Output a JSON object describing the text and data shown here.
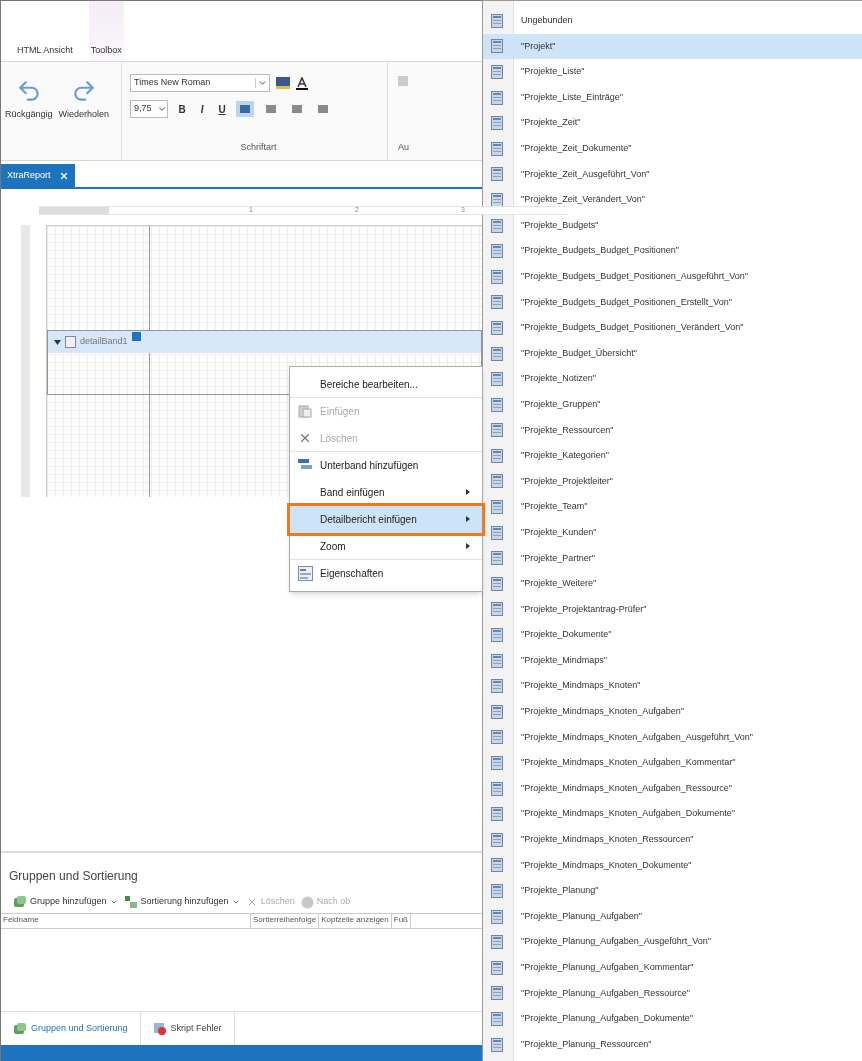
{
  "ribbon": {
    "tabs": [
      {
        "label": "HTML Ansicht",
        "contextual": false
      },
      {
        "label": "Toolbox",
        "contextual": true
      }
    ],
    "undo": "Rückgängig",
    "redo": "Wiederholen",
    "font": {
      "value": "Times New Roman"
    },
    "size": {
      "value": "9,75"
    },
    "format_buttons": [
      {
        "label": "B",
        "kind": "bold"
      },
      {
        "label": "I",
        "kind": "italic"
      },
      {
        "label": "U",
        "kind": "underline"
      }
    ],
    "align_buttons": [
      {
        "selected": true
      },
      {
        "selected": false
      },
      {
        "selected": false
      },
      {
        "selected": false
      }
    ],
    "group_label": "Schriftart",
    "next_group_label": "Au"
  },
  "document_tab": {
    "label": "XtraReport"
  },
  "ruler_labels": [
    "1",
    "2",
    "3"
  ],
  "band": {
    "label": "detailBand1",
    "expanded": true
  },
  "context_menu": [
    {
      "label": "Bereiche bearbeiten...",
      "kind": "none",
      "disabled": false,
      "submenu": false,
      "selected": false,
      "separator_after": true
    },
    {
      "label": "Einfügen",
      "kind": "paste",
      "disabled": true,
      "submenu": false,
      "selected": false,
      "separator_after": false
    },
    {
      "label": "Löschen",
      "kind": "delete",
      "disabled": true,
      "submenu": false,
      "selected": false,
      "separator_after": true
    },
    {
      "label": "Unterband hinzufügen",
      "kind": "subband",
      "disabled": false,
      "submenu": false,
      "selected": false,
      "separator_after": false
    },
    {
      "label": "Band einfügen",
      "kind": "none",
      "disabled": false,
      "submenu": true,
      "selected": false,
      "separator_after": false
    },
    {
      "label": "Detailbericht einfügen",
      "kind": "none",
      "disabled": false,
      "submenu": true,
      "selected": true,
      "separator_after": false
    },
    {
      "label": "Zoom",
      "kind": "none",
      "disabled": false,
      "submenu": true,
      "selected": false,
      "separator_after": true
    },
    {
      "label": "Eigenschaften",
      "kind": "properties",
      "disabled": false,
      "submenu": false,
      "selected": false,
      "separator_after": false
    }
  ],
  "bottom_panel": {
    "title": "Gruppen und Sortierung",
    "toolbar": [
      {
        "label": "Gruppe hinzufügen",
        "kind": "group",
        "dropdown": true,
        "disabled": false
      },
      {
        "label": "Sortierung hinzufügen",
        "kind": "sort",
        "dropdown": true,
        "disabled": false
      },
      {
        "label": "Löschen",
        "kind": "delete",
        "dropdown": false,
        "disabled": true
      },
      {
        "label": "Nach ob",
        "kind": "up",
        "dropdown": false,
        "disabled": true
      }
    ],
    "columns": [
      "Feldname",
      "Sortierreihenfolge",
      "Kopfzeile anzeigen",
      "Fuß"
    ],
    "tabs": [
      {
        "label": "Gruppen und Sortierung",
        "kind": "group",
        "selected": true
      },
      {
        "label": "Skript Fehler",
        "kind": "error",
        "selected": false
      }
    ]
  },
  "data_source_list": [
    {
      "label": "Ungebunden",
      "selected": false
    },
    {
      "label": "\"Projekt\"",
      "selected": true
    },
    {
      "label": "\"Projekte_Liste\"",
      "selected": false
    },
    {
      "label": "\"Projekte_Liste_Einträge\"",
      "selected": false
    },
    {
      "label": "\"Projekte_Zeit\"",
      "selected": false
    },
    {
      "label": "\"Projekte_Zeit_Dokumente\"",
      "selected": false
    },
    {
      "label": "\"Projekte_Zeit_Ausgeführt_Von\"",
      "selected": false
    },
    {
      "label": "\"Projekte_Zeit_Verändert_Von\"",
      "selected": false
    },
    {
      "label": "\"Projekte_Budgets\"",
      "selected": false
    },
    {
      "label": "\"Projekte_Budgets_Budget_Positionen\"",
      "selected": false
    },
    {
      "label": "\"Projekte_Budgets_Budget_Positionen_Ausgeführt_Von\"",
      "selected": false
    },
    {
      "label": "\"Projekte_Budgets_Budget_Positionen_Erstellt_Von\"",
      "selected": false
    },
    {
      "label": "\"Projekte_Budgets_Budget_Positionen_Verändert_Von\"",
      "selected": false
    },
    {
      "label": "\"Projekte_Budget_Übersicht\"",
      "selected": false
    },
    {
      "label": "\"Projekte_Notizen\"",
      "selected": false
    },
    {
      "label": "\"Projekte_Gruppen\"",
      "selected": false
    },
    {
      "label": "\"Projekte_Ressourcen\"",
      "selected": false
    },
    {
      "label": "\"Projekte_Kategorien\"",
      "selected": false
    },
    {
      "label": "\"Projekte_Projektleiter\"",
      "selected": false
    },
    {
      "label": "\"Projekte_Team\"",
      "selected": false
    },
    {
      "label": "\"Projekte_Kunden\"",
      "selected": false
    },
    {
      "label": "\"Projekte_Partner\"",
      "selected": false
    },
    {
      "label": "\"Projekte_Weitere\"",
      "selected": false
    },
    {
      "label": "\"Projekte_Projektantrag-Prüfer\"",
      "selected": false
    },
    {
      "label": "\"Projekte_Dokumente\"",
      "selected": false
    },
    {
      "label": "\"Projekte_Mindmaps\"",
      "selected": false
    },
    {
      "label": "\"Projekte_Mindmaps_Knoten\"",
      "selected": false
    },
    {
      "label": "\"Projekte_Mindmaps_Knoten_Aufgaben\"",
      "selected": false
    },
    {
      "label": "\"Projekte_Mindmaps_Knoten_Aufgaben_Ausgeführt_Von\"",
      "selected": false
    },
    {
      "label": "\"Projekte_Mindmaps_Knoten_Aufgaben_Kommentar\"",
      "selected": false
    },
    {
      "label": "\"Projekte_Mindmaps_Knoten_Aufgaben_Ressource\"",
      "selected": false
    },
    {
      "label": "\"Projekte_Mindmaps_Knoten_Aufgaben_Dokumente\"",
      "selected": false
    },
    {
      "label": "\"Projekte_Mindmaps_Knoten_Ressourcen\"",
      "selected": false
    },
    {
      "label": "\"Projekte_Mindmaps_Knoten_Dokumente\"",
      "selected": false
    },
    {
      "label": "\"Projekte_Planung\"",
      "selected": false
    },
    {
      "label": "\"Projekte_Planung_Aufgaben\"",
      "selected": false
    },
    {
      "label": "\"Projekte_Planung_Aufgaben_Ausgeführt_Von\"",
      "selected": false
    },
    {
      "label": "\"Projekte_Planung_Aufgaben_Kommentar\"",
      "selected": false
    },
    {
      "label": "\"Projekte_Planung_Aufgaben_Ressource\"",
      "selected": false
    },
    {
      "label": "\"Projekte_Planung_Aufgaben_Dokumente\"",
      "selected": false
    },
    {
      "label": "\"Projekte_Planung_Ressourcen\"",
      "selected": false
    }
  ]
}
